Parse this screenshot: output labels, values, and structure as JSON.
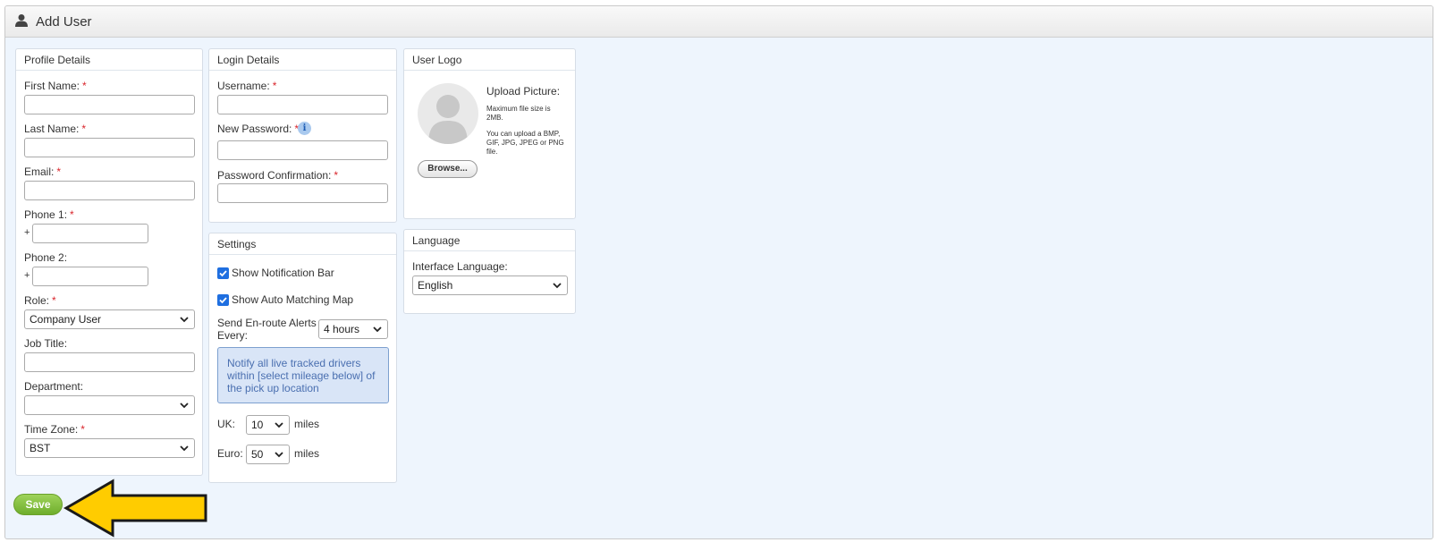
{
  "header": {
    "title": "Add User",
    "icon": "user-icon"
  },
  "profile": {
    "heading": "Profile Details",
    "first_name_label": "First Name:",
    "last_name_label": "Last Name:",
    "email_label": "Email:",
    "phone1_label": "Phone 1:",
    "phone2_label": "Phone 2:",
    "phone_prefix": "+",
    "role_label": "Role:",
    "role_value": "Company User",
    "job_title_label": "Job Title:",
    "department_label": "Department:",
    "department_value": "",
    "timezone_label": "Time Zone:",
    "timezone_value": "BST",
    "required_mark": "*"
  },
  "login": {
    "heading": "Login Details",
    "username_label": "Username:",
    "password_label": "New Password:",
    "confirm_label": "Password Confirmation:",
    "info_glyph": "i"
  },
  "settings": {
    "heading": "Settings",
    "show_notification_bar": "Show Notification Bar",
    "show_auto_matching_map": "Show Auto Matching Map",
    "send_alerts_label": "Send En-route Alerts Every:",
    "send_alerts_value": "4 hours",
    "notice": "Notify all live tracked drivers within [select mileage below] of the pick up location",
    "uk_label": "UK:",
    "uk_value": "10",
    "euro_label": "Euro:",
    "euro_value": "50",
    "miles_label": "miles"
  },
  "logo": {
    "heading": "User Logo",
    "upload_title": "Upload Picture:",
    "max_size": "Maximum file size is 2MB.",
    "formats": "You can upload a BMP, GIF, JPG, JPEG or PNG file.",
    "browse_label": "Browse..."
  },
  "language": {
    "heading": "Language",
    "interface_label": "Interface Language:",
    "interface_value": "English"
  },
  "actions": {
    "save_label": "Save"
  },
  "colors": {
    "accent": "#1f6fe0",
    "save": "#7dbb3c",
    "arrow": "#ffcc00",
    "required": "#d9262c"
  }
}
